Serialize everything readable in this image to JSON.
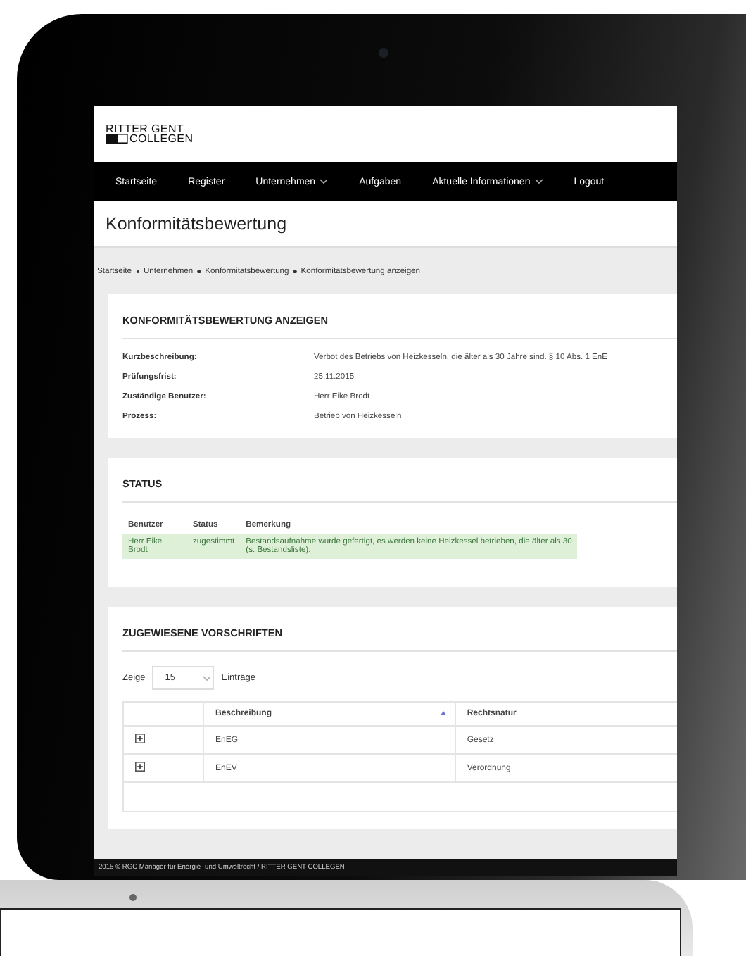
{
  "logo": {
    "line1": "RITTER GENT",
    "line2": "COLLEGEN"
  },
  "nav": [
    {
      "label": "Startseite",
      "dropdown": false
    },
    {
      "label": "Register",
      "dropdown": false
    },
    {
      "label": "Unternehmen",
      "dropdown": true
    },
    {
      "label": "Aufgaben",
      "dropdown": false
    },
    {
      "label": "Aktuelle Informationen",
      "dropdown": true
    },
    {
      "label": "Logout",
      "dropdown": false
    }
  ],
  "page_title": "Konformitätsbewertung",
  "breadcrumb": [
    "Startseite",
    "Unternehmen",
    "Konformitätsbewertung",
    "Konformitätsbewertung anzeigen"
  ],
  "details": {
    "title": "KONFORMITÄTSBEWERTUNG ANZEIGEN",
    "fields": [
      {
        "label": "Kurzbeschreibung:",
        "value": "Verbot des Betriebs von Heizkesseln, die älter als 30 Jahre sind. § 10 Abs. 1 EnE"
      },
      {
        "label": "Prüfungsfrist:",
        "value": "25.11.2015"
      },
      {
        "label": "Zuständige Benutzer:",
        "value": "Herr Eike Brodt"
      },
      {
        "label": "Prozess:",
        "value": "Betrieb von Heizkesseln"
      }
    ]
  },
  "status": {
    "title": "STATUS",
    "columns": [
      "Benutzer",
      "Status",
      "Bemerkung"
    ],
    "rows": [
      {
        "kind": "success",
        "user": "Herr Eike Brodt",
        "status": "zugestimmt",
        "remark_lines": [
          "Bestandsaufnahme wurde gefertigt, es werden keine Heizkessel betrieben, die älter als 30",
          "(s. Bestandsliste)."
        ]
      }
    ]
  },
  "regulations": {
    "title": "ZUGEWIESENE VORSCHRIFTEN",
    "length": {
      "before": "Zeige",
      "value": "15",
      "after": "Einträge"
    },
    "columns": [
      {
        "label": "Beschreibung",
        "sorted": true
      },
      {
        "label": "Rechtsnatur",
        "sorted": false
      }
    ],
    "rows": [
      {
        "description": "EnEG",
        "type": "Gesetz"
      },
      {
        "description": "EnEV",
        "type": "Verordnung"
      }
    ]
  },
  "footer": "2015 © RGC Manager für Energie- und Umweltrecht / RITTER GENT COLLEGEN"
}
